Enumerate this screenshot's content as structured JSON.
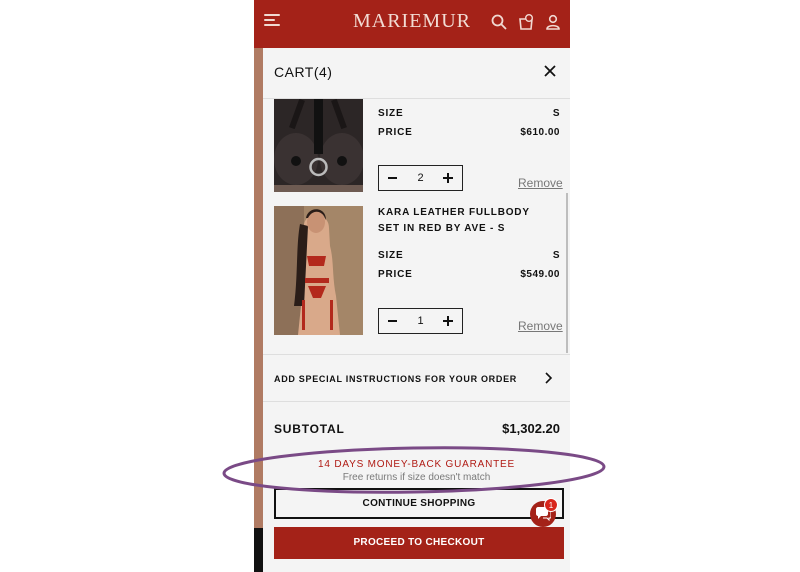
{
  "header": {
    "logo": "MARIEMUR",
    "menu_icon": "hamburger-menu-icon",
    "search_icon": "search-icon",
    "wishlist_icon": "bag-heart-icon",
    "account_icon": "user-icon",
    "bg_color": "#a42218"
  },
  "cart": {
    "title": "CART(4)",
    "close_icon": "close-icon",
    "items": [
      {
        "name": "",
        "size_label": "SIZE",
        "size": "S",
        "price_label": "PRICE",
        "price": "$610.00",
        "quantity": "2",
        "remove_label": "Remove"
      },
      {
        "name_line1": "KARA LEATHER FULLBODY",
        "name_line2": "SET IN RED BY AVE - S",
        "size_label": "SIZE",
        "size": "S",
        "price_label": "PRICE",
        "price": "$549.00",
        "quantity": "1",
        "remove_label": "Remove"
      }
    ],
    "special_instructions": "ADD SPECIAL INSTRUCTIONS FOR YOUR ORDER",
    "subtotal_label": "SUBTOTAL",
    "subtotal_value": "$1,302.20",
    "guarantee_title": "14 DAYS MONEY-BACK GUARANTEE",
    "guarantee_sub": "Free returns if size doesn't match",
    "continue_label": "CONTINUE SHOPPING",
    "checkout_label": "PROCEED TO CHECKOUT"
  },
  "chat": {
    "icon": "chat-icon",
    "badge": "1"
  },
  "annotation": {
    "oval_color": "#7a4a86"
  }
}
